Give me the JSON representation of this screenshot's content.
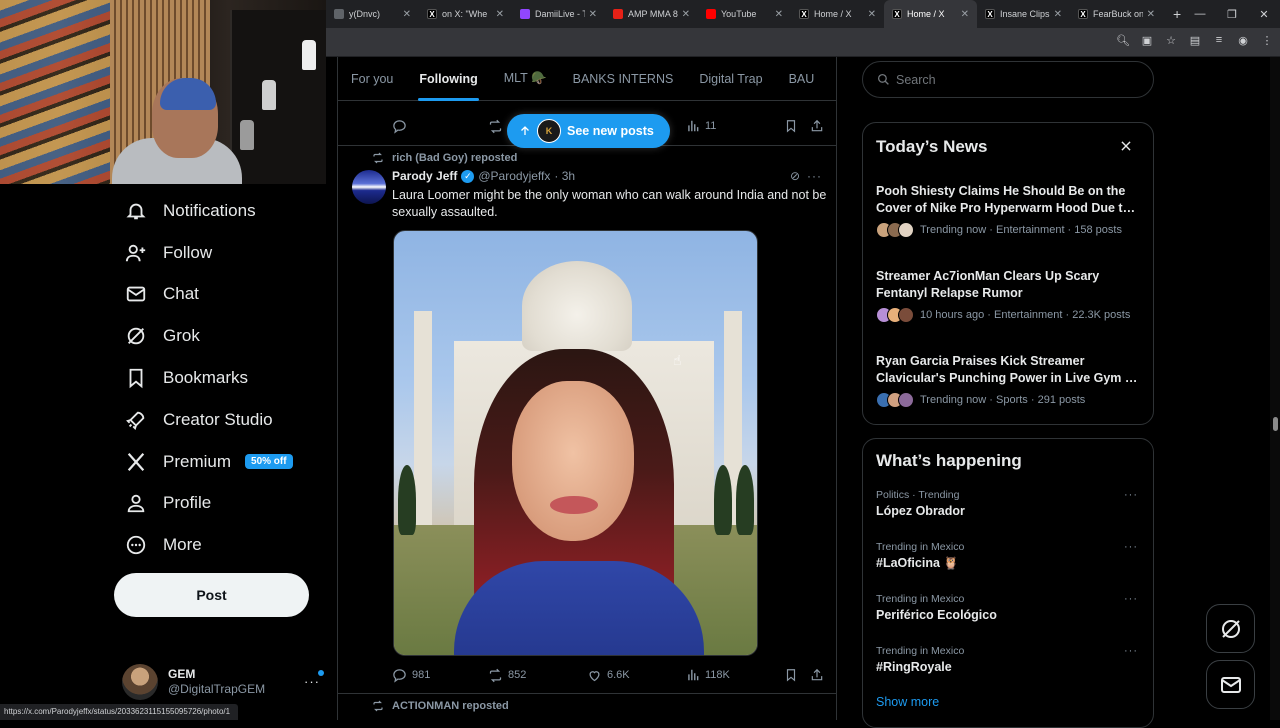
{
  "browser": {
    "tabs": [
      {
        "label": "y(Dnvc)",
        "fav": "",
        "color": "#5f6368"
      },
      {
        "label": "on X: \"Whe",
        "fav": "X",
        "color": "#000000"
      },
      {
        "label": "DamiiLive - T",
        "fav": "",
        "color": "#9146ff"
      },
      {
        "label": "AMP MMA 8",
        "fav": "",
        "color": "#e62117"
      },
      {
        "label": "YouTube",
        "fav": "",
        "color": "#ff0000"
      },
      {
        "label": "Home / X",
        "fav": "X",
        "color": "#000000"
      },
      {
        "label": "Home / X",
        "fav": "X",
        "color": "#000000",
        "active": true
      },
      {
        "label": "Insane Clips",
        "fav": "X",
        "color": "#000000"
      },
      {
        "label": "FearBuck on",
        "fav": "X",
        "color": "#000000"
      }
    ],
    "new_tab": "+",
    "status_url": "https://x.com/Parodyjeffx/status/2033623115155095726/photo/1"
  },
  "nav": {
    "items": [
      {
        "label": "Notifications",
        "icon": "bell-icon"
      },
      {
        "label": "Follow",
        "icon": "follow-icon"
      },
      {
        "label": "Chat",
        "icon": "mail-icon"
      },
      {
        "label": "Grok",
        "icon": "grok-icon"
      },
      {
        "label": "Bookmarks",
        "icon": "bookmark-icon"
      },
      {
        "label": "Creator Studio",
        "icon": "rocket-icon"
      },
      {
        "label": "Premium",
        "icon": "x-logo-icon",
        "badge": "50% off"
      },
      {
        "label": "Profile",
        "icon": "person-icon"
      },
      {
        "label": "More",
        "icon": "more-circle-icon"
      }
    ],
    "post_label": "Post",
    "account": {
      "name": "GEM",
      "handle": "@DigitalTrapGEM",
      "more": "···"
    }
  },
  "feed": {
    "tabs": [
      "For you",
      "Following",
      "MLT 🪖",
      "BANKS INTERNS",
      "Digital Trap",
      "BAU"
    ],
    "active_tab": 1,
    "prev_tweet": {
      "views": "11"
    },
    "new_posts_label": "See new posts",
    "tweet": {
      "reposted_by": "rich (Bad Goy) reposted",
      "name": "Parody Jeff",
      "handle": "@Parodyjeffx",
      "time": "· 3h",
      "text": "Laura Loomer might be the only woman who can walk around India and not be sexually assaulted.",
      "replies": "981",
      "reposts": "852",
      "likes": "6.6K",
      "views": "118K"
    },
    "next_repost": "ACTIONMAN reposted"
  },
  "right": {
    "search_placeholder": "Search",
    "news": {
      "title": "Today’s News",
      "items": [
        {
          "headline": "Pooh Shiesty Claims He Should Be on the Cover of Nike Pro Hyperwarm Hood Due t…",
          "meta": "Trending now · Entertainment · 158 posts"
        },
        {
          "headline": "Streamer Ac7ionMan Clears Up Scary Fentanyl Relapse Rumor",
          "meta": "10 hours ago · Entertainment · 22.3K posts"
        },
        {
          "headline": "Ryan Garcia Praises Kick Streamer Clavicular's Punching Power in Live Gym …",
          "meta": "Trending now · Sports · 291 posts"
        }
      ]
    },
    "happening": {
      "title": "What’s happening",
      "items": [
        {
          "meta": "Politics · Trending",
          "name": "López Obrador"
        },
        {
          "meta": "Trending in Mexico",
          "name": "#LaOficina 🦉"
        },
        {
          "meta": "Trending in Mexico",
          "name": "Periférico Ecológico"
        },
        {
          "meta": "Trending in Mexico",
          "name": "#RingRoyale"
        }
      ],
      "show_more": "Show more"
    }
  },
  "colors": {
    "accent": "#1d9bf0",
    "background": "#000000",
    "border": "#2f3336",
    "muted": "#8b98a5"
  }
}
